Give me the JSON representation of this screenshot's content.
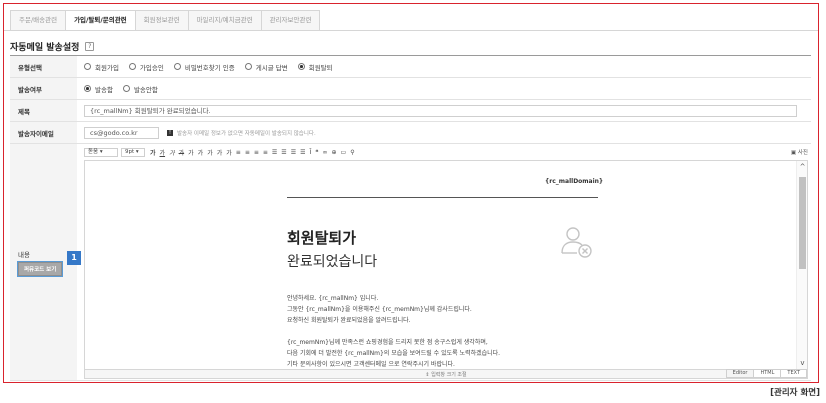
{
  "tabs": [
    {
      "label": "주문/배송관련"
    },
    {
      "label": "가입/탈퇴/문의관련"
    },
    {
      "label": "회원정보관련"
    },
    {
      "label": "마일리지/예치금관련"
    },
    {
      "label": "관리자보안관련"
    }
  ],
  "section": {
    "title": "자동메일 발송설정",
    "help": "?"
  },
  "form": {
    "type": {
      "label": "유형선택",
      "options": [
        {
          "label": "회원가입"
        },
        {
          "label": "가입승인"
        },
        {
          "label": "비밀번호찾기 인증"
        },
        {
          "label": "게시글 답변"
        },
        {
          "label": "회원탈퇴"
        }
      ]
    },
    "send": {
      "label": "발송여부",
      "options": [
        {
          "label": "발송함"
        },
        {
          "label": "발송안함"
        }
      ]
    },
    "subject": {
      "label": "제목",
      "value": "{rc_mallNm} 회원탈퇴가 완료되었습니다."
    },
    "sender": {
      "label": "발송자이메일",
      "value": "cs@godo.co.kr",
      "info_icon": "!",
      "note": "발송자 이메일 정보가 없으면 자동메일이 발송되지 않습니다."
    },
    "content": {
      "label": "내용",
      "source_button": "퍼뮤코드 보기",
      "badge": "1"
    }
  },
  "editor": {
    "toolbar": {
      "font": "돋움",
      "size": "9pt",
      "tools": [
        "가",
        "가",
        "가",
        "가",
        "가",
        "가",
        "가",
        "가",
        "가",
        "≡",
        "≡",
        "≡",
        "≡",
        "☰",
        "☰",
        "☰",
        "☰",
        "Ī",
        "❝",
        "∞",
        "⊕",
        "▭",
        "⚲"
      ],
      "photo": "사진"
    },
    "content": {
      "domain": "{rc_mallDomain}",
      "headline1": "회원탈퇴가",
      "headline2": "완료되었습니다",
      "para1": [
        "안녕하세요. {rc_mallNm} 입니다.",
        "그동안 {rc_mallNm}을 이용해주신 {rc_memNm}님께 감사드립니다.",
        "요청하신 회원탈퇴가 완료되었음을 알려드립니다."
      ],
      "para2": [
        "{rc_memNm}님께 만족스런 쇼핑경험을 드리지 못한 점 송구스럽게 생각하며,",
        "다음 기회에 더 발전한 {rc_mallNm}의 모습을 보여드릴 수 있도록 노력하겠습니다.",
        "기타 문의사항이 있으시면 고객센터메일 으로 연락주시기 바랍니다."
      ]
    },
    "resize_label": "입력창 크기 조절",
    "modes": [
      "Editor",
      "HTML",
      "TEXT"
    ]
  },
  "caption": "[관리자 화면]",
  "colors": {
    "frame": "#d9232d",
    "badge": "#3578c8"
  }
}
